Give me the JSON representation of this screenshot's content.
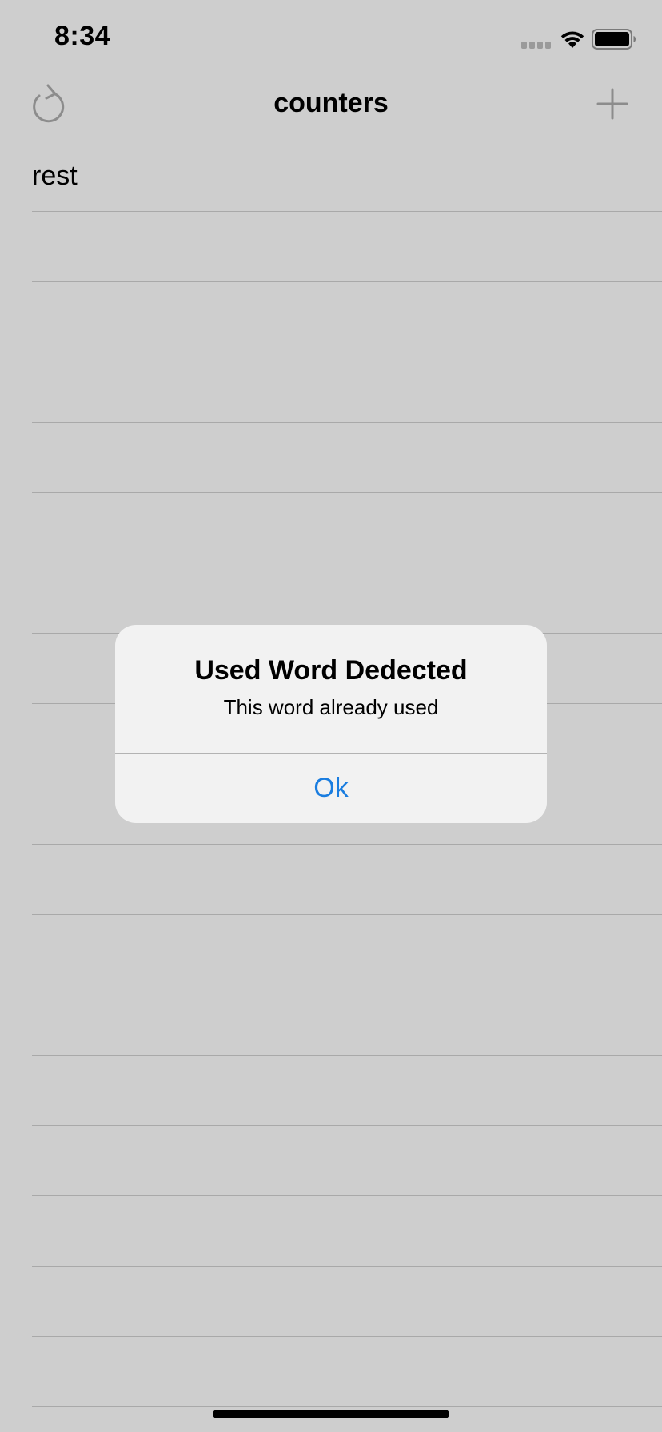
{
  "status_bar": {
    "time": "8:34"
  },
  "nav": {
    "title": "counters",
    "left_icon": "refresh-icon",
    "right_icon": "plus-icon"
  },
  "list": {
    "items": [
      "rest",
      "",
      "",
      "",
      "",
      "",
      "",
      "",
      "",
      "",
      "",
      "",
      "",
      "",
      "",
      "",
      "",
      ""
    ]
  },
  "alert": {
    "title": "Used Word Dedected",
    "message": "This word already used",
    "ok_label": "Ok"
  },
  "colors": {
    "background": "#cecece",
    "alert_background": "#f2f2f2",
    "accent": "#1a7de0",
    "icon_gray": "#8c8c8c"
  }
}
